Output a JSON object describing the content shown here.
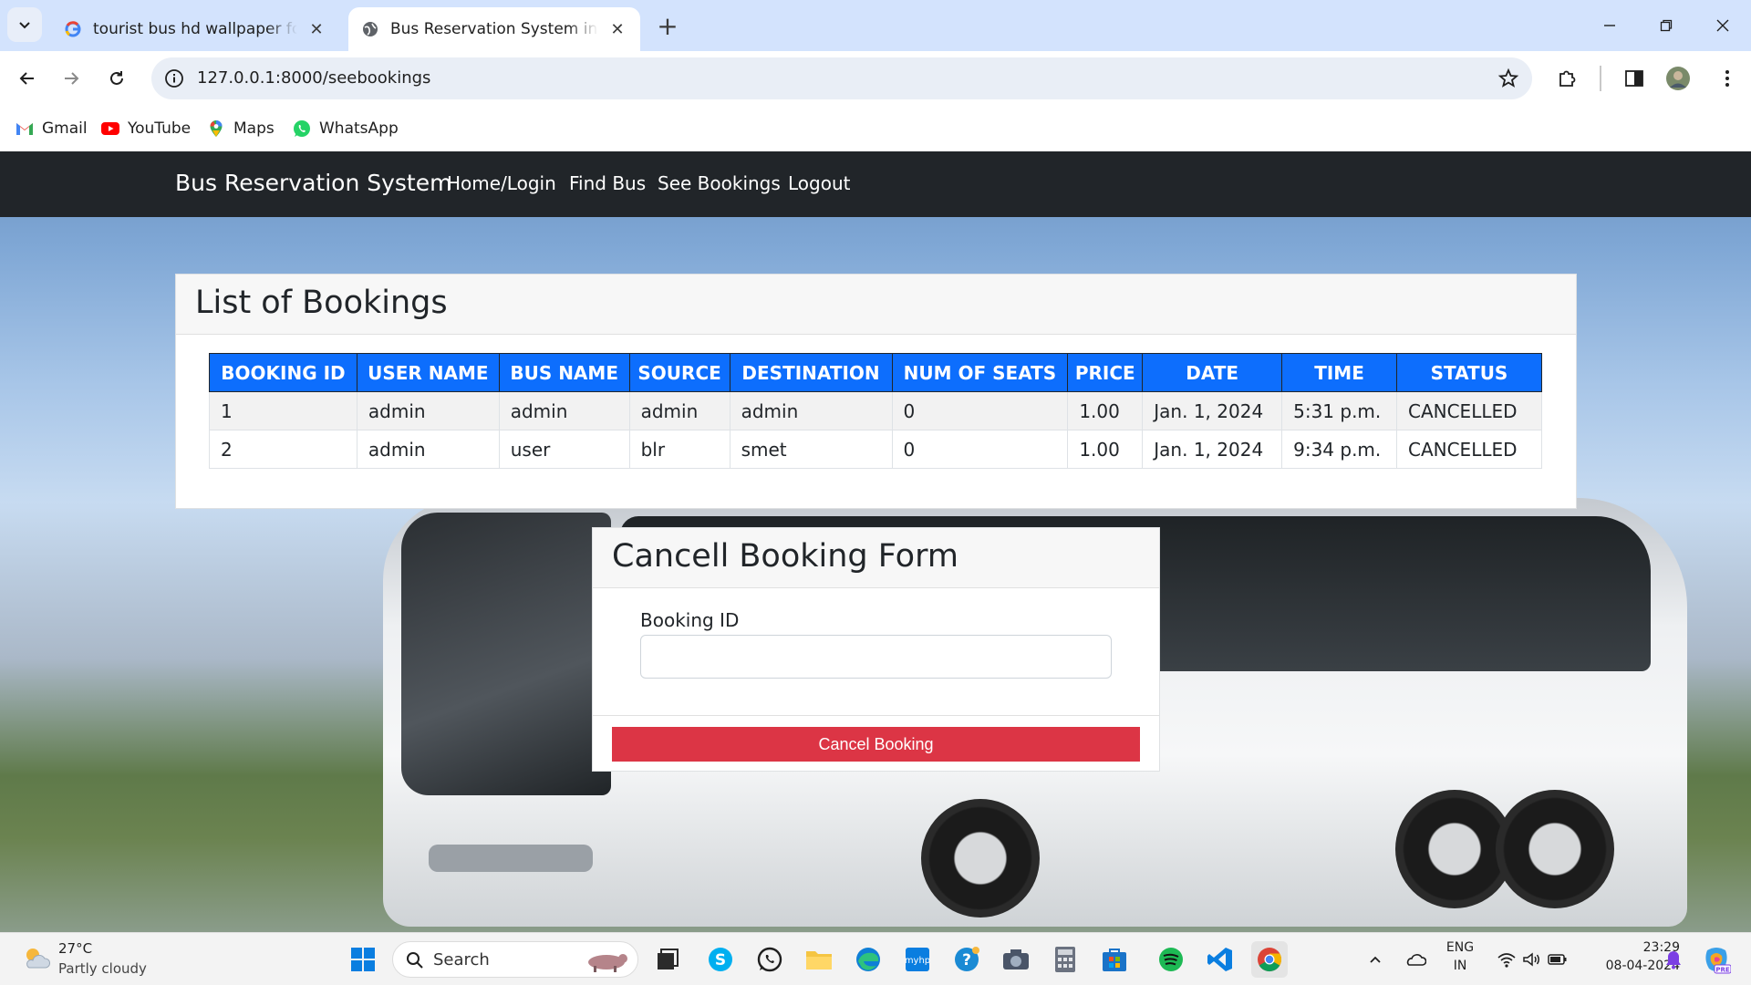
{
  "browser": {
    "tabs": [
      {
        "title": "tourist bus hd wallpaper for lap",
        "favicon": "google-g-icon"
      },
      {
        "title": "Bus Reservation System in Djan",
        "favicon": "globe-icon"
      }
    ],
    "url": "127.0.0.1:8000/seebookings",
    "bookmarks": [
      {
        "label": "Gmail",
        "icon": "gmail-icon"
      },
      {
        "label": "YouTube",
        "icon": "youtube-icon"
      },
      {
        "label": "Maps",
        "icon": "maps-icon"
      },
      {
        "label": "WhatsApp",
        "icon": "whatsapp-icon"
      }
    ]
  },
  "navbar": {
    "brand": "Bus Reservation System",
    "links": [
      "Home/Login",
      "Find Bus",
      "See Bookings",
      "Logout"
    ]
  },
  "bookings": {
    "title": "List of Bookings",
    "columns": [
      "BOOKING ID",
      "USER NAME",
      "BUS NAME",
      "SOURCE",
      "DESTINATION",
      "NUM OF SEATS",
      "PRICE",
      "DATE",
      "TIME",
      "STATUS"
    ],
    "rows": [
      [
        "1",
        "admin",
        "admin",
        "admin",
        "admin",
        "0",
        "1.00",
        "Jan. 1, 2024",
        "5:31 p.m.",
        "CANCELLED"
      ],
      [
        "2",
        "admin",
        "user",
        "blr",
        "smet",
        "0",
        "1.00",
        "Jan. 1, 2024",
        "9:34 p.m.",
        "CANCELLED"
      ]
    ]
  },
  "cancel_form": {
    "title": "Cancell Booking Form",
    "field_label": "Booking ID",
    "field_value": "",
    "button_label": "Cancel Booking"
  },
  "taskbar": {
    "weather_temp": "27°C",
    "weather_desc": "Partly cloudy",
    "search_placeholder": "Search",
    "lang_top": "ENG",
    "lang_bottom": "IN",
    "time": "23:29",
    "date": "08-04-2024"
  },
  "colors": {
    "tabstrip": "#d3e3fd",
    "navbar": "#212529",
    "table_header": "#0d6efd",
    "danger": "#dc3545"
  }
}
